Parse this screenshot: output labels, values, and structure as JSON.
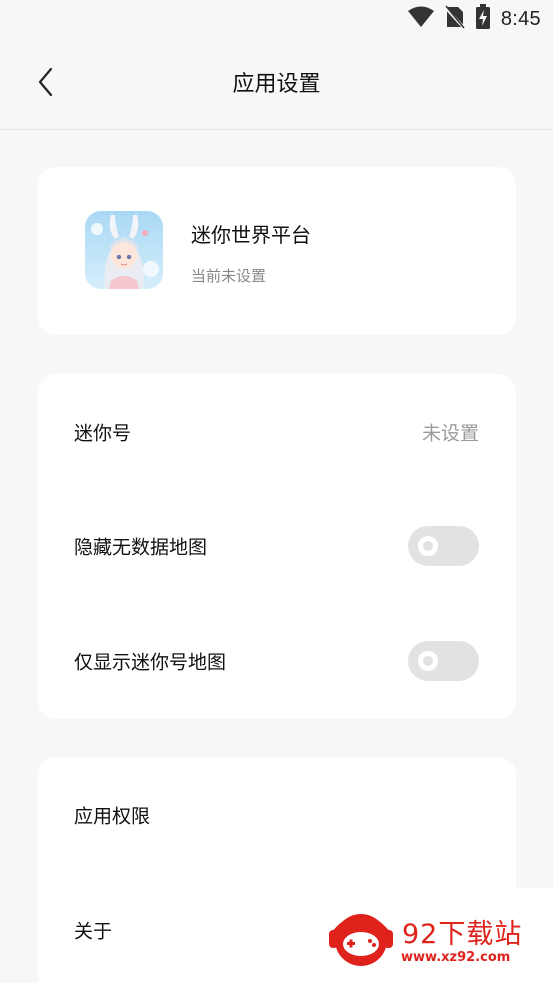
{
  "status_bar": {
    "time": "8:45",
    "icons": [
      "wifi-icon",
      "no-sim-icon",
      "battery-charging-icon"
    ]
  },
  "header": {
    "back_icon": "chevron-left-icon",
    "title": "应用设置"
  },
  "app_card": {
    "icon": "app-avatar-anime-girl",
    "name": "迷你世界平台",
    "status": "当前未设置"
  },
  "settings": {
    "rows": [
      {
        "label": "迷你号",
        "value": "未设置"
      },
      {
        "label": "隐藏无数据地图",
        "toggle_on": false
      },
      {
        "label": "仅显示迷你号地图",
        "toggle_on": false
      }
    ]
  },
  "more": {
    "rows": [
      {
        "label": "应用权限"
      },
      {
        "label": "关于"
      }
    ]
  },
  "watermark": {
    "title": "92下载站",
    "url": "www.xz92.com"
  },
  "colors": {
    "background": "#f7f7f7",
    "card": "#ffffff",
    "toggle_off": "#e2e2e2",
    "watermark_red": "#e0221c"
  }
}
